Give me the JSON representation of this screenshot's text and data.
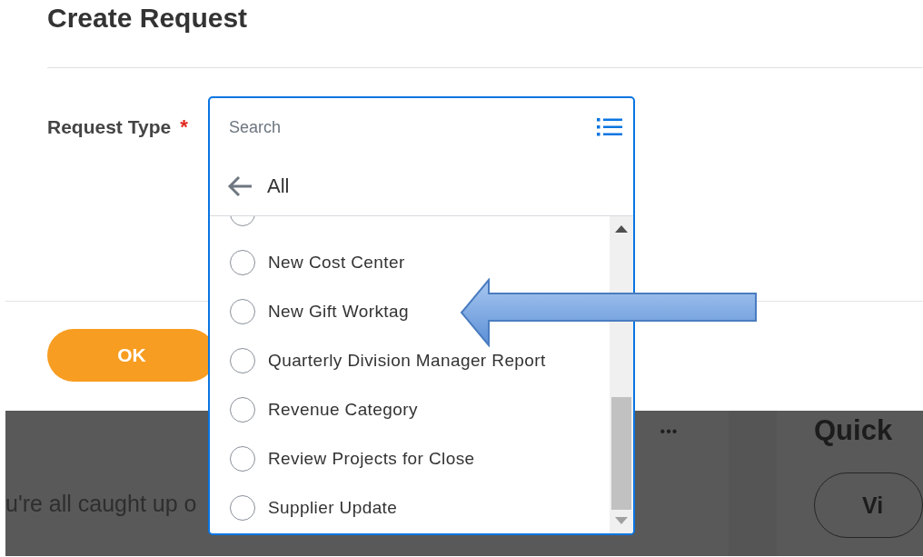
{
  "page": {
    "title": "Create Request"
  },
  "field": {
    "label": "Request Type",
    "required_mark": "*"
  },
  "dropdown": {
    "search": {
      "placeholder": "Search"
    },
    "back_label": "All",
    "options": [
      {
        "kind": "partial",
        "selected": false
      },
      {
        "kind": "full",
        "label": "New Cost Center",
        "selected": false
      },
      {
        "kind": "full",
        "label": "New Gift Worktag",
        "selected": false
      },
      {
        "kind": "full",
        "label": "Quarterly Division Manager Report",
        "selected": false
      },
      {
        "kind": "full",
        "label": "Revenue Category",
        "selected": false
      },
      {
        "kind": "full",
        "label": "Review Projects for Close",
        "selected": false
      },
      {
        "kind": "full",
        "label": "Supplier Update",
        "selected": false
      }
    ]
  },
  "ok_button": "OK",
  "background": {
    "message": "u're all caught up o",
    "more_menu": "•••",
    "side_heading": "Quick",
    "side_button": "Vi"
  }
}
